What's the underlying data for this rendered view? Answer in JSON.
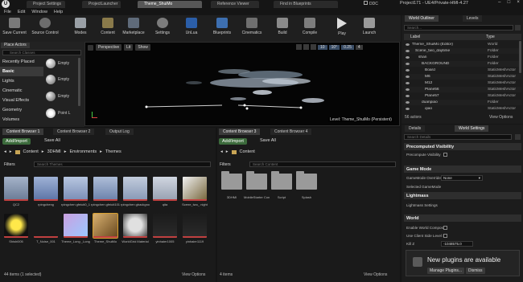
{
  "window": {
    "tabs": [
      "Project Settings",
      "ProjectLauncher",
      "Theme_ShuiMo",
      "Reference Viewer",
      "Find in Blueprints"
    ],
    "right_title": "Project171 - UE4/Private-HMI-4.27",
    "source_control": "DDC"
  },
  "menu": [
    "File",
    "Edit",
    "Window",
    "Help"
  ],
  "toolbar": [
    "Save Current",
    "Source Control",
    "Modes",
    "Content",
    "Marketplace",
    "Settings",
    "UnLua",
    "Blueprints",
    "Cinematics",
    "Build",
    "Compile",
    "Play",
    "Launch"
  ],
  "place_actors": {
    "tab": "Place Actors",
    "search_placeholder": "Search Classes",
    "categories": [
      "Recently Placed",
      "Basic",
      "Lights",
      "Cinematic",
      "Visual Effects",
      "Geometry",
      "Volumes"
    ],
    "items": [
      "Empty",
      "Empty",
      "Empty",
      "Point L"
    ]
  },
  "viewport": {
    "perspective": "Perspective",
    "lit": "Lit",
    "show": "Show",
    "snap_values": [
      "10",
      "10°",
      "0.25",
      "4"
    ],
    "level_label": "Level:  Theme_ShuiMo (Persistent)"
  },
  "outliner": {
    "tab1": "World Outliner",
    "tab2": "Levels",
    "search_placeholder": "Search...",
    "col_label": "Label",
    "col_type": "Type",
    "rows": [
      {
        "label": "Theme_ShuiMo (Editor)",
        "type": "World"
      },
      {
        "label": "Scene_two_daytime",
        "type": "Folder"
      },
      {
        "label": "shan",
        "type": "Folder"
      },
      {
        "label": "BACKGROUND",
        "type": "Folder"
      },
      {
        "label": "Board",
        "type": "StaticMeshActor"
      },
      {
        "label": "M6",
        "type": "StaticMeshActor"
      },
      {
        "label": "M12",
        "type": "StaticMeshActor"
      },
      {
        "label": "Plane56",
        "type": "StaticMeshActor"
      },
      {
        "label": "Plane57",
        "type": "StaticMeshActor"
      },
      {
        "label": "duanpiao",
        "type": "Folder"
      },
      {
        "label": "qiao",
        "type": "StaticMeshActor"
      }
    ],
    "count": "56 actors",
    "view_options": "View Options"
  },
  "details": {
    "tab1": "Details",
    "tab2": "World Settings",
    "search_placeholder": "Search Details",
    "sections": [
      {
        "title": "Precomputed Visibility",
        "props": [
          "Precompute Visibility"
        ]
      },
      {
        "title": "Game Mode",
        "props": [
          "GameMode Override",
          "Selected GameMode"
        ]
      },
      {
        "title": "Lightmass",
        "props": [
          "Lightmass Settings"
        ]
      },
      {
        "title": "World",
        "props": [
          "Enable World Composi",
          "Use Client Side Level S",
          "Kill Z"
        ]
      }
    ],
    "gamemode_value": "None",
    "killz_value": "-1048575.0"
  },
  "notification": {
    "title": "New plugins are available",
    "manage": "Manage Plugins...",
    "dismiss": "Dismiss"
  },
  "content_left": {
    "tabs": [
      "Content Browser 1",
      "Content Browser 2",
      "Output Log"
    ],
    "add_import": "Add/Import",
    "save_all": "Save All",
    "breadcrumb": [
      "Content",
      "3DHMI",
      "Environments",
      "Themes"
    ],
    "filters": "Filters",
    "search_placeholder": "Search Themes",
    "row1": [
      "QC2",
      "rpingcheng",
      "rpingchen\ngfeiuti0_12",
      "rpingchen\ngfeiuti1019",
      "rpingchen\ngbackground",
      "qita",
      "Scene_two_\nnight"
    ],
    "row2": [
      "Shishi005",
      "T_Noise_001",
      "Theme_Long\n_Long",
      "Theme_ShuiMo",
      "WorldGrid\nMaterial",
      "yinhaier1005",
      "yinhaier1119"
    ],
    "status": "44 items (1 selected)",
    "view_options": "View Options"
  },
  "content_right": {
    "tabs": [
      "Content Browser 3",
      "Content Browser 4"
    ],
    "add_import": "Add/Import",
    "save_all": "Save All",
    "breadcrumb": [
      "Content"
    ],
    "filters": "Filters",
    "search_placeholder": "Search Content",
    "folders": [
      "3DHMI",
      "MobileStarter\nContent",
      "Script",
      "Splash"
    ],
    "status": "4 items",
    "view_options": "View Options"
  }
}
